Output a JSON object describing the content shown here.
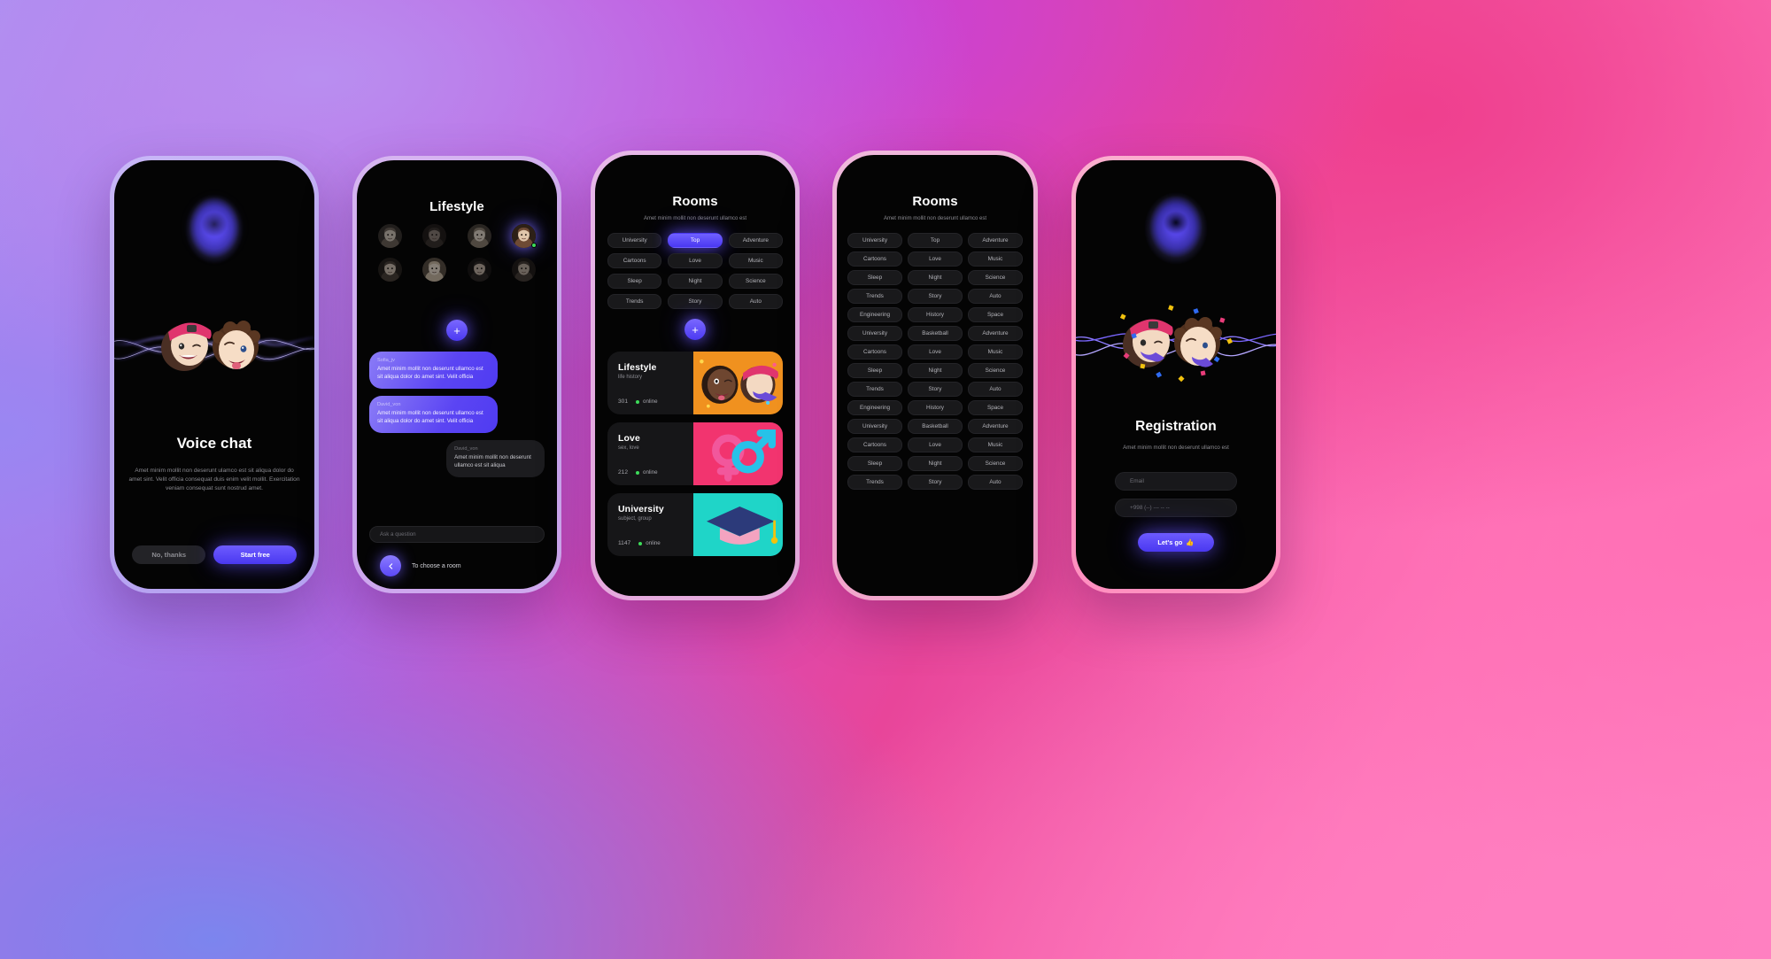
{
  "palette": {
    "accent": "#5b45f3",
    "accent_light": "#8b7cf6",
    "online_green": "#3ddc5a",
    "screen_bg": "#040404",
    "card_bg": "#161618",
    "tag_bg": "#19191b",
    "bg_purple": "#a98ef2",
    "bg_magenta": "#c552d8",
    "bg_pink": "#ff86c4",
    "bg_blue": "#7c85ee"
  },
  "screens": [
    {
      "id": "voice-chat",
      "title": "Voice chat",
      "description": "Amet minim mollit non deserunt ulamco est sit aliqua dolor do amet sint. Velit officia consequat duis enim velit mollit. Exercitation veniam consequat sunt nostrud amet.",
      "buttons": {
        "secondary": "No, thanks",
        "primary": "Start free"
      },
      "icons": {
        "orb": "voice-orb-icon",
        "waves": "sound-wave-icon",
        "memoji": "memoji-pair-icon"
      }
    },
    {
      "id": "lifestyle",
      "title": "Lifestyle",
      "avatars": [
        {
          "name": "user-1",
          "online": false,
          "active": false
        },
        {
          "name": "user-2",
          "online": false,
          "active": false
        },
        {
          "name": "user-3",
          "online": false,
          "active": false
        },
        {
          "name": "user-4",
          "online": true,
          "active": true
        },
        {
          "name": "user-5",
          "online": false,
          "active": false
        },
        {
          "name": "user-6",
          "online": false,
          "active": false
        },
        {
          "name": "user-7",
          "online": false,
          "active": false
        },
        {
          "name": "user-8",
          "online": false,
          "active": false
        }
      ],
      "add_label": "+",
      "messages": [
        {
          "author": "Sofia_jv",
          "text": "Amet minim mollit non deserunt ullamco est sit aliqua dolor do amet sint. Velit officia",
          "side": "them"
        },
        {
          "author": "David_von",
          "text": "Amet minim mollit non deserunt ullamco est sit aliqua dolor do amet sint. Velit officia",
          "side": "them"
        },
        {
          "author": "David_von",
          "text": "Amet minim mollit non deserunt ullamco est sit aliqua",
          "side": "me"
        }
      ],
      "input_placeholder": "Ask a question",
      "footer_label": "To choose a room",
      "back_icon": "chevron-left-icon"
    },
    {
      "id": "rooms-top",
      "title": "Rooms",
      "subtitle": "Amet minim mollit non deserunt ullamco est",
      "tags": [
        {
          "label": "University",
          "active": false
        },
        {
          "label": "Top",
          "active": true
        },
        {
          "label": "Adventure",
          "active": false
        },
        {
          "label": "Cartoons",
          "active": false
        },
        {
          "label": "Love",
          "active": false
        },
        {
          "label": "Music",
          "active": false
        },
        {
          "label": "Sleep",
          "active": false
        },
        {
          "label": "Night",
          "active": false
        },
        {
          "label": "Science",
          "active": false
        },
        {
          "label": "Trends",
          "active": false
        },
        {
          "label": "Story",
          "active": false
        },
        {
          "label": "Auto",
          "active": false
        }
      ],
      "add_label": "+",
      "cards": [
        {
          "name": "Lifestyle",
          "sub": "life history",
          "count": "301",
          "status": "online",
          "art": "memoji-party-art",
          "art_color": "#f0911f"
        },
        {
          "name": "Love",
          "sub": "sex, love",
          "count": "212",
          "status": "online",
          "art": "gender-symbols-art",
          "art_color": "#f2346f"
        },
        {
          "name": "University",
          "sub": "subject, group",
          "count": "1147",
          "status": "online",
          "art": "graduation-cap-art",
          "art_color": "#1fd5c8"
        }
      ]
    },
    {
      "id": "rooms-all",
      "title": "Rooms",
      "subtitle": "Amet minim mollit non deserunt ullamco est",
      "tags": [
        {
          "label": "University",
          "active": false
        },
        {
          "label": "Top",
          "active": false
        },
        {
          "label": "Adventure",
          "active": false
        },
        {
          "label": "Cartoons",
          "active": false
        },
        {
          "label": "Love",
          "active": false
        },
        {
          "label": "Music",
          "active": false
        },
        {
          "label": "Sleep",
          "active": false
        },
        {
          "label": "Night",
          "active": false
        },
        {
          "label": "Science",
          "active": false
        },
        {
          "label": "Trends",
          "active": false
        },
        {
          "label": "Story",
          "active": false
        },
        {
          "label": "Auto",
          "active": false
        },
        {
          "label": "Engineering",
          "active": false
        },
        {
          "label": "History",
          "active": false
        },
        {
          "label": "Space",
          "active": false
        },
        {
          "label": "University",
          "active": false
        },
        {
          "label": "Basketball",
          "active": false
        },
        {
          "label": "Adventure",
          "active": false
        },
        {
          "label": "Cartoons",
          "active": false
        },
        {
          "label": "Love",
          "active": false
        },
        {
          "label": "Music",
          "active": false
        },
        {
          "label": "Sleep",
          "active": false
        },
        {
          "label": "Night",
          "active": false
        },
        {
          "label": "Science",
          "active": false
        },
        {
          "label": "Trends",
          "active": false
        },
        {
          "label": "Story",
          "active": false
        },
        {
          "label": "Auto",
          "active": false
        },
        {
          "label": "Engineering",
          "active": false
        },
        {
          "label": "History",
          "active": false
        },
        {
          "label": "Space",
          "active": false
        },
        {
          "label": "University",
          "active": false
        },
        {
          "label": "Basketball",
          "active": false
        },
        {
          "label": "Adventure",
          "active": false
        },
        {
          "label": "Cartoons",
          "active": false
        },
        {
          "label": "Love",
          "active": false
        },
        {
          "label": "Music",
          "active": false
        },
        {
          "label": "Sleep",
          "active": false
        },
        {
          "label": "Night",
          "active": false
        },
        {
          "label": "Science",
          "active": false
        },
        {
          "label": "Trends",
          "active": false
        },
        {
          "label": "Story",
          "active": false
        },
        {
          "label": "Auto",
          "active": false
        }
      ]
    },
    {
      "id": "registration",
      "title": "Registration",
      "subtitle": "Amet minim mollit non deserunt ullamco est",
      "fields": [
        {
          "name": "email",
          "placeholder": "Email",
          "value": ""
        },
        {
          "name": "phone",
          "placeholder": "+998 (--) --- -- --",
          "value": ""
        }
      ],
      "submit_label": "Let's go",
      "submit_emoji": "👍",
      "icons": {
        "orb": "voice-orb-icon",
        "memoji": "memoji-pair-icon",
        "confetti": "confetti-icon"
      }
    }
  ]
}
